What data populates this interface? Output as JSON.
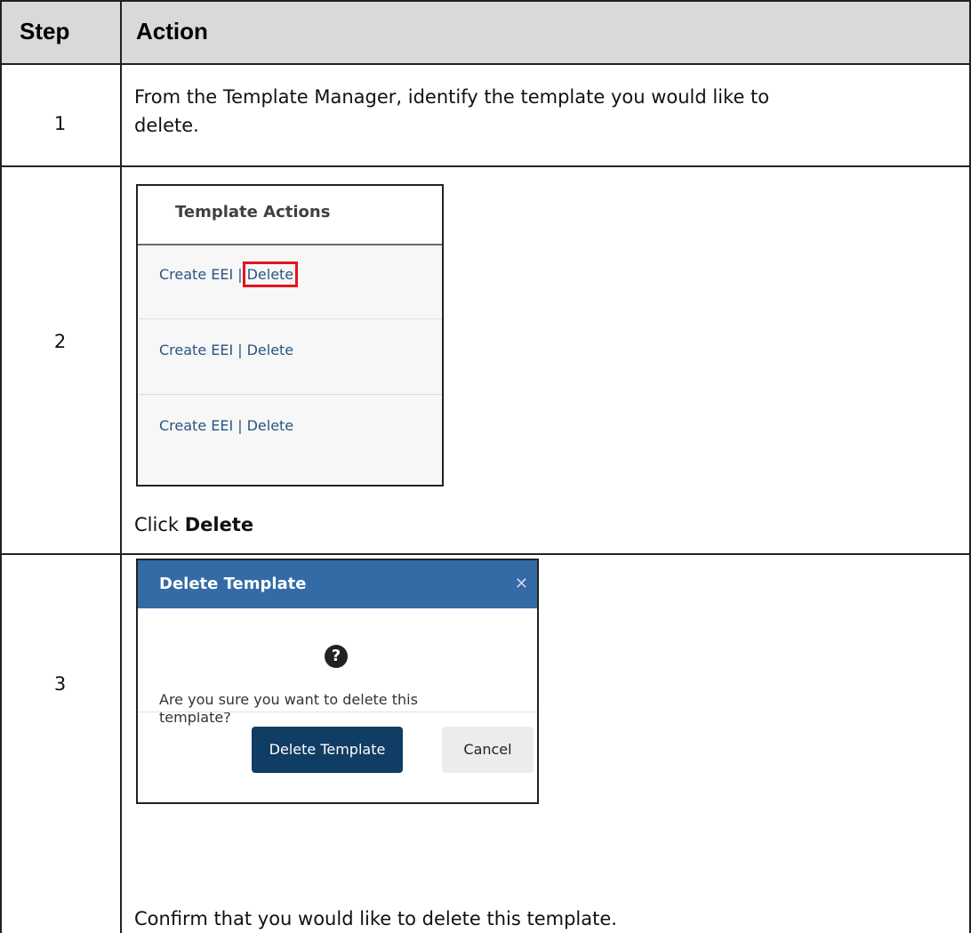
{
  "table": {
    "headers": {
      "step": "Step",
      "action": "Action"
    },
    "rows": [
      {
        "step": "1",
        "text_line1": "From the Template Manager, identify the template you would like to",
        "text_line2": "delete."
      },
      {
        "step": "2",
        "instruction_prefix": "Click ",
        "instruction_bold": "Delete"
      },
      {
        "step": "3",
        "instruction": "Confirm that you would like to delete this template."
      }
    ]
  },
  "template_actions": {
    "title": "Template Actions",
    "rows": [
      {
        "create": "Create EEI",
        "separator": "|",
        "delete": "Delete",
        "highlighted": true
      },
      {
        "create": "Create EEI",
        "separator": "|",
        "delete": "Delete",
        "highlighted": false
      },
      {
        "create": "Create EEI",
        "separator": "|",
        "delete": "Delete",
        "highlighted": false
      }
    ],
    "highlight_color": "#e8131f"
  },
  "delete_dialog": {
    "title": "Delete Template",
    "close_icon": "close-icon",
    "question_icon": "question-circle-icon",
    "message_line1": "Are you sure you want to delete this",
    "message_line2": "template?",
    "confirm_label": "Delete Template",
    "cancel_label": "Cancel",
    "header_color": "#346aa5",
    "confirm_color": "#0f3d63"
  }
}
